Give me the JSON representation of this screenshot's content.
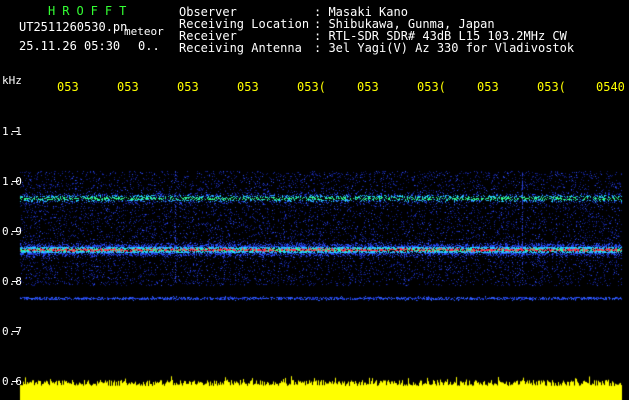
{
  "header": {
    "station_code": "HROFFT",
    "filename": "UT2511260530.pn",
    "filename_suffix": "meteor",
    "timestamp": "25.11.26 05:30",
    "count": "0.."
  },
  "info": {
    "labels": [
      "Observer",
      "Receiving Location",
      "Receiver",
      "Receiving Antenna"
    ],
    "values": [
      ": Masaki Kano",
      ": Shibukawa, Gunma, Japan",
      ": RTL-SDR SDR# 43dB L15 103.2MHz CW",
      ": 3el Yagi(V) Az 330 for Vladivostok"
    ]
  },
  "time_axis": {
    "labels": [
      "053",
      "053",
      "053",
      "053",
      "053(",
      "053",
      "053(",
      "053",
      "053(",
      "0540"
    ]
  },
  "freq_axis": {
    "unit": "kHz",
    "labels": [
      "1.1",
      "1.0",
      "0.9",
      "0.8",
      "0.7",
      "0.6"
    ]
  },
  "colors": {
    "text": "#ffffff",
    "accent_yellow": "#ffff00",
    "accent_green": "#33ff33",
    "spectrum_low": "#1020a0",
    "spectrum_mid": "#20d0ff",
    "spectrum_high": "#ff2040"
  },
  "spectrogram": {
    "bands_khz": [
      0.965,
      0.862,
      0.765
    ],
    "band_strength": [
      "medium",
      "strong",
      "weak"
    ],
    "noise_range_khz": [
      0.79,
      1.02
    ]
  }
}
